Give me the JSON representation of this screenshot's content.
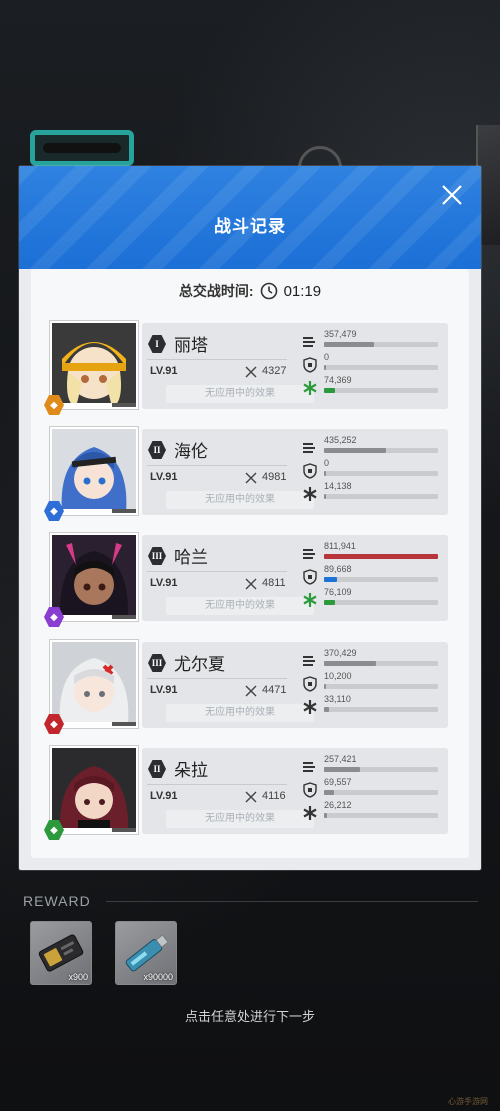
{
  "panel": {
    "title": "战斗记录",
    "total_time_label": "总交战时间:",
    "total_time_value": "01:19"
  },
  "effect_placeholder": "无应用中的效果",
  "level_label": "LV.91",
  "characters": [
    {
      "rank": "I",
      "name": "丽塔",
      "level": "LV.91",
      "power": "4327",
      "element_color": "#e08a1a",
      "portrait_theme": "yellow-helmet",
      "damage": "357,479",
      "damage_ratio": 0.44,
      "shield": "0",
      "shield_ratio": 0.0,
      "heal": "74,369",
      "heal_ratio": 0.1
    },
    {
      "rank": "II",
      "name": "海伦",
      "level": "LV.91",
      "power": "4981",
      "element_color": "#2d6fd6",
      "portrait_theme": "blue-hair",
      "damage": "435,252",
      "damage_ratio": 0.54,
      "shield": "0",
      "shield_ratio": 0.0,
      "heal": "14,138",
      "heal_ratio": 0.02
    },
    {
      "rank": "III",
      "name": "哈兰",
      "level": "LV.91",
      "power": "4811",
      "element_color": "#8a3ed1",
      "portrait_theme": "dark-hair-red",
      "damage": "811,941",
      "damage_ratio": 1.0,
      "shield": "89,668",
      "shield_ratio": 0.11,
      "heal": "76,109",
      "heal_ratio": 0.1
    },
    {
      "rank": "III",
      "name": "尤尔夏",
      "level": "LV.91",
      "power": "4471",
      "element_color": "#c0262c",
      "portrait_theme": "white-hair",
      "damage": "370,429",
      "damage_ratio": 0.46,
      "shield": "10,200",
      "shield_ratio": 0.02,
      "heal": "33,110",
      "heal_ratio": 0.04
    },
    {
      "rank": "II",
      "name": "朵拉",
      "level": "LV.91",
      "power": "4116",
      "element_color": "#2c9a3c",
      "portrait_theme": "red-brown-hair",
      "damage": "257,421",
      "damage_ratio": 0.32,
      "shield": "69,557",
      "shield_ratio": 0.09,
      "heal": "26,212",
      "heal_ratio": 0.03
    }
  ],
  "colors": {
    "header_blue": "#1f72d8",
    "damage_bar": "#8a8c90",
    "damage_bar_top": "#b8363b",
    "shield_bar": "#8a8c90",
    "shield_bar_top": "#1f72d8",
    "heal_bar": "#2c9a3c"
  },
  "reward": {
    "label": "REWARD",
    "items": [
      {
        "name": "credit-card-icon",
        "qty": "x900"
      },
      {
        "name": "usb-drive-icon",
        "qty": "x90000"
      }
    ]
  },
  "continue_hint": "点击任意处进行下一步",
  "watermark": "心游手游网"
}
